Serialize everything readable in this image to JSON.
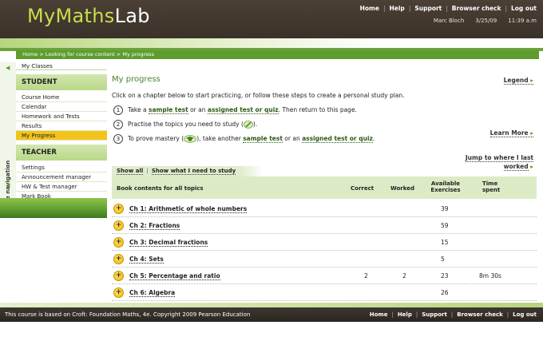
{
  "header": {
    "logo_part1": "MyMaths",
    "logo_part2": "Lab",
    "links": [
      "Home",
      "Help",
      "Support",
      "Browser check",
      "Log out"
    ],
    "user": "Marc Bloch",
    "date": "3/25/09",
    "time": "11:39 a.m"
  },
  "breadcrumb": "Home > Looking for course content > My progress",
  "sidebar": {
    "hide_nav": "Hide navigation",
    "my_classes": "My Classes",
    "student_heading": "STUDENT",
    "student_items": [
      "Course Home",
      "Calendar",
      "Homework and Tests",
      "Results",
      "My Progress"
    ],
    "teacher_heading": "TEACHER",
    "teacher_items": [
      "Settings",
      "Announcement manager",
      "HW & Test manager",
      "Mark Book"
    ]
  },
  "main": {
    "title": "My progress",
    "legend": "Legend",
    "intro": "Click on a chapter below to start practicing, or follow these steps to create a personal study plan.",
    "step1": {
      "num": "1",
      "pre": "Take a ",
      "link1": "sample test",
      "mid": " or an ",
      "link2": "assigned test or quiz",
      "post": ". Then return to this page."
    },
    "step2": {
      "num": "2",
      "text": "Practise the topics you need to study (",
      "post": ")."
    },
    "step3": {
      "num": "3",
      "pre": "To prove mastery (",
      "mid": "), take another ",
      "link1": "sample test",
      "mid2": " or an ",
      "link2": "assigned test or quiz",
      "post": "."
    },
    "learn_more": "Learn More",
    "jump_line1": "Jump to where I last",
    "jump_line2": "worked",
    "tab_all": "Show all",
    "tab_need": "Show what I need to study"
  },
  "table": {
    "headers": {
      "contents": "Book contents for all topics",
      "correct": "Correct",
      "worked": "Worked",
      "available_1": "Available",
      "available_2": "Exercises",
      "time_1": "Time",
      "time_2": "spent"
    },
    "rows": [
      {
        "chapter": "Ch 1: Arithmetic of whole numbers",
        "correct": "",
        "worked": "",
        "available": "39",
        "time": ""
      },
      {
        "chapter": "Ch 2: Fractions",
        "correct": "",
        "worked": "",
        "available": "59",
        "time": ""
      },
      {
        "chapter": "Ch 3: Decimal fractions",
        "correct": "",
        "worked": "",
        "available": "15",
        "time": ""
      },
      {
        "chapter": "Ch 4: Sets",
        "correct": "",
        "worked": "",
        "available": "5",
        "time": ""
      },
      {
        "chapter": "Ch 5: Percentage and ratio",
        "correct": "2",
        "worked": "2",
        "available": "23",
        "time": "8m 30s"
      },
      {
        "chapter": "Ch 6: Algebra",
        "correct": "",
        "worked": "",
        "available": "26",
        "time": ""
      }
    ]
  },
  "footer": {
    "copyright": "This course is based on Croft: Foundation Maths, 4e. Copyright 2009 Pearson Education",
    "links": [
      "Home",
      "Help",
      "Support",
      "Browser check",
      "Log out"
    ]
  }
}
